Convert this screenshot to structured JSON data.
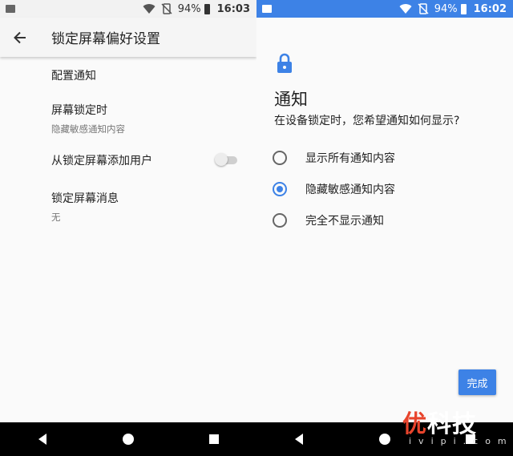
{
  "left_screen": {
    "status_bar": {
      "battery": "94%",
      "time": "16:03"
    },
    "app_bar": {
      "title": "锁定屏幕偏好设置"
    },
    "settings": [
      {
        "title": "配置通知",
        "summary": ""
      },
      {
        "title": "屏幕锁定时",
        "summary": "隐藏敏感通知内容"
      },
      {
        "title": "从锁定屏幕添加用户",
        "summary": "",
        "toggle": "off"
      },
      {
        "title": "锁定屏幕消息",
        "summary": "无"
      }
    ]
  },
  "right_screen": {
    "status_bar": {
      "battery": "94%",
      "time": "16:02"
    },
    "dialog": {
      "heading": "通知",
      "question": "在设备锁定时，您希望通知如何显示?",
      "options": [
        {
          "label": "显示所有通知内容",
          "selected": false
        },
        {
          "label": "隐藏敏感通知内容",
          "selected": true
        },
        {
          "label": "完全不显示通知",
          "selected": false
        }
      ],
      "done_label": "完成"
    }
  },
  "watermark": {
    "text_prefix": "优",
    "text_rest": "科技",
    "subtext": "ivipi.com"
  },
  "colors": {
    "accent": "#3d82e6",
    "watermark_accent": "#e8442c"
  }
}
